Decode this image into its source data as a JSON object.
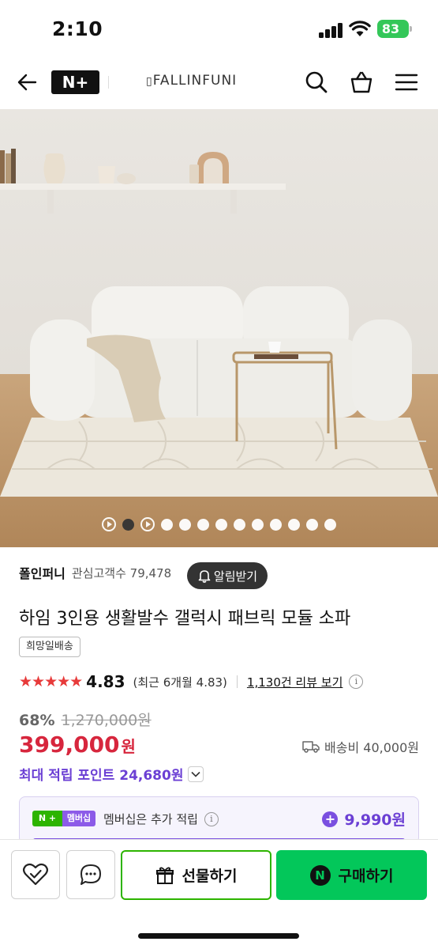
{
  "status_bar": {
    "time": "2:10",
    "battery": "83"
  },
  "header": {
    "nplus_logo": "N+",
    "brand": "FALLINFUNI",
    "icons": [
      "back-arrow-icon",
      "search-icon",
      "cart-icon",
      "menu-icon"
    ]
  },
  "gallery": {
    "dot_count": 11,
    "active_index": 1
  },
  "seller": {
    "name": "폴인퍼니",
    "fans_label": "관심고객수 79,478",
    "alarm_label": "알림받기"
  },
  "product": {
    "title": "하임 3인용 생활발수 갤럭시 패브릭 모듈 소파",
    "tag": "희망일배송",
    "stars": "★★★★★",
    "rating": "4.83",
    "recent_rating": "(최근 6개월 4.83)",
    "reviews_link": "1,130건 리뷰 보기",
    "info_glyph": "i"
  },
  "price": {
    "discount": "68%",
    "original": "1,270,000원",
    "sale_number": "399,000",
    "sale_unit": "원",
    "shipping": "배송비 40,000원",
    "points": "최대 적립 포인트 24,680원"
  },
  "membership": {
    "badge_n": "N +",
    "badge_label": "멤버십",
    "text": "멤버십은 추가 적립",
    "points": "9,990원"
  },
  "actions": {
    "gift_label": "선물하기",
    "buy_label": "구매하기",
    "buy_badge": "N"
  },
  "colors": {
    "accent_green": "#03c75a",
    "price_red": "#d7263d",
    "purple": "#6b3fd4"
  }
}
